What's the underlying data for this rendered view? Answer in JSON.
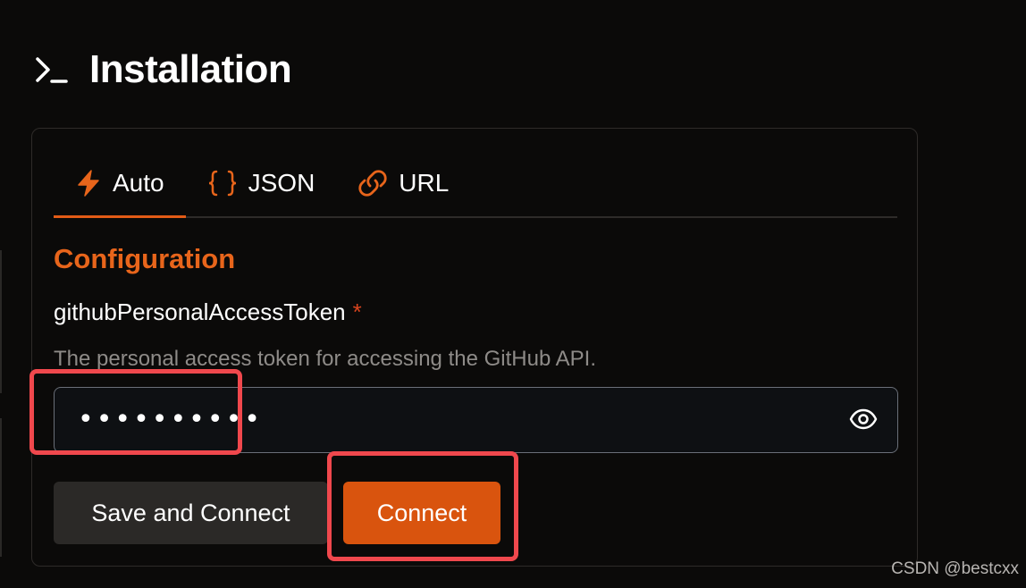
{
  "header": {
    "title": "Installation",
    "icon": "terminal-prompt-icon"
  },
  "tabs": [
    {
      "label": "Auto",
      "icon": "lightning-icon",
      "active": true
    },
    {
      "label": "JSON",
      "icon": "braces-icon",
      "active": false
    },
    {
      "label": "URL",
      "icon": "link-icon",
      "active": false
    }
  ],
  "config": {
    "title": "Configuration",
    "field_label": "githubPersonalAccessToken",
    "required_mark": "*",
    "field_description": "The personal access token for accessing the GitHub API.",
    "token_value": "••••••••••",
    "visibility_icon": "eye-icon"
  },
  "buttons": {
    "save_connect": "Save and Connect",
    "connect": "Connect"
  },
  "watermark": "CSDN @bestcxx",
  "colors": {
    "accent": "#e35b16",
    "primary_button": "#d9540e",
    "secondary_button": "#2b2927",
    "background": "#0b0a09",
    "highlight": "#f0484d"
  }
}
